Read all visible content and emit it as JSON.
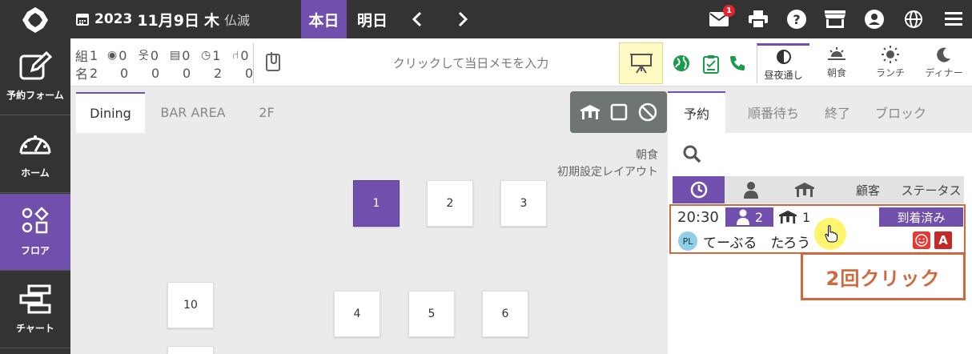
{
  "header": {
    "date_year": "2023",
    "date_monthday": "11月9日",
    "date_weekday": "木",
    "date_rokuyo": "仏滅",
    "today_label": "本日",
    "tomorrow_label": "明日",
    "mail_badge": "1"
  },
  "sidebar": {
    "items": [
      {
        "label": "予約フォーム",
        "icon": "edit-icon"
      },
      {
        "label": "ホーム",
        "icon": "dashboard-icon"
      },
      {
        "label": "フロア",
        "icon": "shapes-icon"
      },
      {
        "label": "チャート",
        "icon": "chart-icon"
      }
    ]
  },
  "stats": {
    "row1_label": "組",
    "row2_label": "名",
    "groups": [
      "1",
      "0",
      "0",
      "0",
      "1",
      "0"
    ],
    "people": [
      "2",
      "0",
      "0",
      "0",
      "2",
      "0"
    ]
  },
  "memo": {
    "placeholder": "クリックして当日メモを入力"
  },
  "meals": [
    {
      "label": "昼夜通し",
      "icon": "half-circle-icon"
    },
    {
      "label": "朝食",
      "icon": "sunrise-icon"
    },
    {
      "label": "ランチ",
      "icon": "sun-icon"
    },
    {
      "label": "ディナー",
      "icon": "moon-icon"
    }
  ],
  "floor": {
    "tabs": [
      "Dining",
      "BAR AREA",
      "2F"
    ],
    "layout_label_1": "朝食",
    "layout_label_2": "初期設定レイアウト",
    "tables": [
      "1",
      "2",
      "3",
      "10",
      "4",
      "5",
      "6"
    ]
  },
  "panel": {
    "tabs": [
      "予約",
      "順番待ち",
      "終了",
      "ブロック"
    ],
    "columns": {
      "customer": "顧客",
      "status": "ステータス"
    },
    "reservation": {
      "time": "20:30",
      "party_size": "2",
      "table": "1",
      "status": "到着済み",
      "badge": "PL",
      "name": "てーぶる　たろう"
    }
  },
  "callout": {
    "text": "2回クリック"
  },
  "colors": {
    "accent": "#7150ad",
    "topbar": "#333333",
    "highlight": "#d0683d",
    "green": "#1a9a4a"
  }
}
